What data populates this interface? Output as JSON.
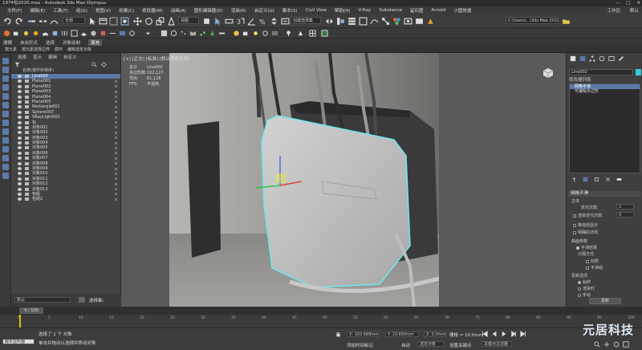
{
  "window": {
    "title": "1974包2020.max - Autodesk 3ds Max Olympus",
    "controls": [
      "—",
      "□",
      "✕"
    ]
  },
  "menu": {
    "items": [
      "文件(F)",
      "编辑(E)",
      "工具(T)",
      "组(G)",
      "视图(V)",
      "创建(C)",
      "修改器(M)",
      "动画(A)",
      "图形编辑器(D)",
      "渲染(R)",
      "自定义(U)",
      "脚本(S)",
      "Civil View",
      "帮助(H)",
      "V-Ray",
      "Substance",
      "鲨石图",
      "Arnold",
      "小图快速"
    ],
    "right": [
      "工作区:",
      "默认"
    ]
  },
  "toolbar": {
    "selection_filter": "全部",
    "ref_coord": "视图",
    "named_selection": "创建选择集",
    "workspace_path": "C:\\Users\\...\\3ds Max 2024"
  },
  "ribbon": {
    "tabs": [
      "建模",
      "自由形式",
      "选择",
      "对象绘制",
      "填充"
    ],
    "sub": [
      "多边形建模",
      "修改选择",
      "编辑",
      "几何体(全部)",
      "细分",
      "三角剖分",
      "对齐"
    ],
    "row2": [
      "按元素",
      "按元素选择边界",
      "循环",
      "编辑选定对象"
    ]
  },
  "scene": {
    "tabs": [
      "选择",
      "显示",
      "编辑",
      "自定义"
    ],
    "header": "名称(按升序排序)",
    "items": [
      {
        "name": "Line002",
        "selected": true
      },
      {
        "name": "Plane001",
        "selected": false
      },
      {
        "name": "Plane002",
        "selected": false
      },
      {
        "name": "Plane003",
        "selected": false
      },
      {
        "name": "Plane004",
        "selected": false
      },
      {
        "name": "Plane005",
        "selected": false
      },
      {
        "name": "Rectangle001",
        "selected": false
      },
      {
        "name": "Sphere007",
        "selected": false
      },
      {
        "name": "VRayLight001",
        "selected": false
      },
      {
        "name": "包",
        "selected": false
      },
      {
        "name": "对象001",
        "selected": false
      },
      {
        "name": "对象002",
        "selected": false
      },
      {
        "name": "对象003",
        "selected": false
      },
      {
        "name": "对象004",
        "selected": false
      },
      {
        "name": "对象005",
        "selected": false
      },
      {
        "name": "对象006",
        "selected": false
      },
      {
        "name": "对象007",
        "selected": false
      },
      {
        "name": "对象008",
        "selected": false
      },
      {
        "name": "对象009",
        "selected": false
      },
      {
        "name": "对象010",
        "selected": false
      },
      {
        "name": "对象011",
        "selected": false
      },
      {
        "name": "对象012",
        "selected": false
      },
      {
        "name": "对象013",
        "selected": false
      },
      {
        "name": "包组",
        "selected": false
      },
      {
        "name": "包组2",
        "selected": false
      }
    ],
    "footer_layer": "默认",
    "footer_label": "选择集:"
  },
  "viewport": {
    "label": "[+] [正交] [标准] [默认明暗处理]",
    "stats": [
      {
        "k": "总计",
        "v": "Line002"
      },
      {
        "k": "多边形数:",
        "v": "102,127"
      },
      {
        "k": "顶点:",
        "v": "61,126"
      },
      {
        "k": "FPS:",
        "v": "不适用"
      }
    ]
  },
  "command_panel": {
    "object_name": "Line002",
    "modifier_list": "修改器列表",
    "stack": [
      "网格平滑",
      "可编辑多边形"
    ],
    "rollout_title": "网格平滑",
    "section1": "主体",
    "iterations_label": "迭代次数:",
    "iterations_value": "1",
    "smoothness_label": "渲染迭代次数:",
    "smoothness_value": "0",
    "options": [
      "等值线显示",
      "明确的法线"
    ],
    "surface_section": "曲面参数",
    "surface_opts": [
      "平滑结果",
      "分隔方式:",
      "材质",
      "平滑组"
    ],
    "update_section": "更新选项",
    "update_opts": [
      "始终",
      "渲染时",
      "手动"
    ],
    "update_btn": "更新"
  },
  "timeline": {
    "current": "0 / 100",
    "ticks": [
      "0",
      "5",
      "10",
      "15",
      "20",
      "25",
      "30",
      "35",
      "40",
      "45",
      "50",
      "55",
      "60",
      "65",
      "70",
      "75",
      "80",
      "85",
      "90",
      "95",
      "100"
    ]
  },
  "status": {
    "script": "脚本监听器",
    "message1": "选择了 1 个 对象",
    "message2": "单击并拖动以选择并移动对象",
    "x": "X: 103.688mm",
    "y": "Y: 10.600mm",
    "z": "Z: 0.0mm",
    "grid": "栅格 = 10.0mm",
    "autokey": "自动",
    "setkey": "设置关键点",
    "selected": "选定对象",
    "filters": "关键点过滤器",
    "add_time_tag": "添加时间标记"
  },
  "watermark": "元居科技",
  "colors": {
    "selection_blue": "#5b7aa8",
    "object_cyan": "#38c9d6",
    "timeslider_yellow": "#e8c000"
  }
}
